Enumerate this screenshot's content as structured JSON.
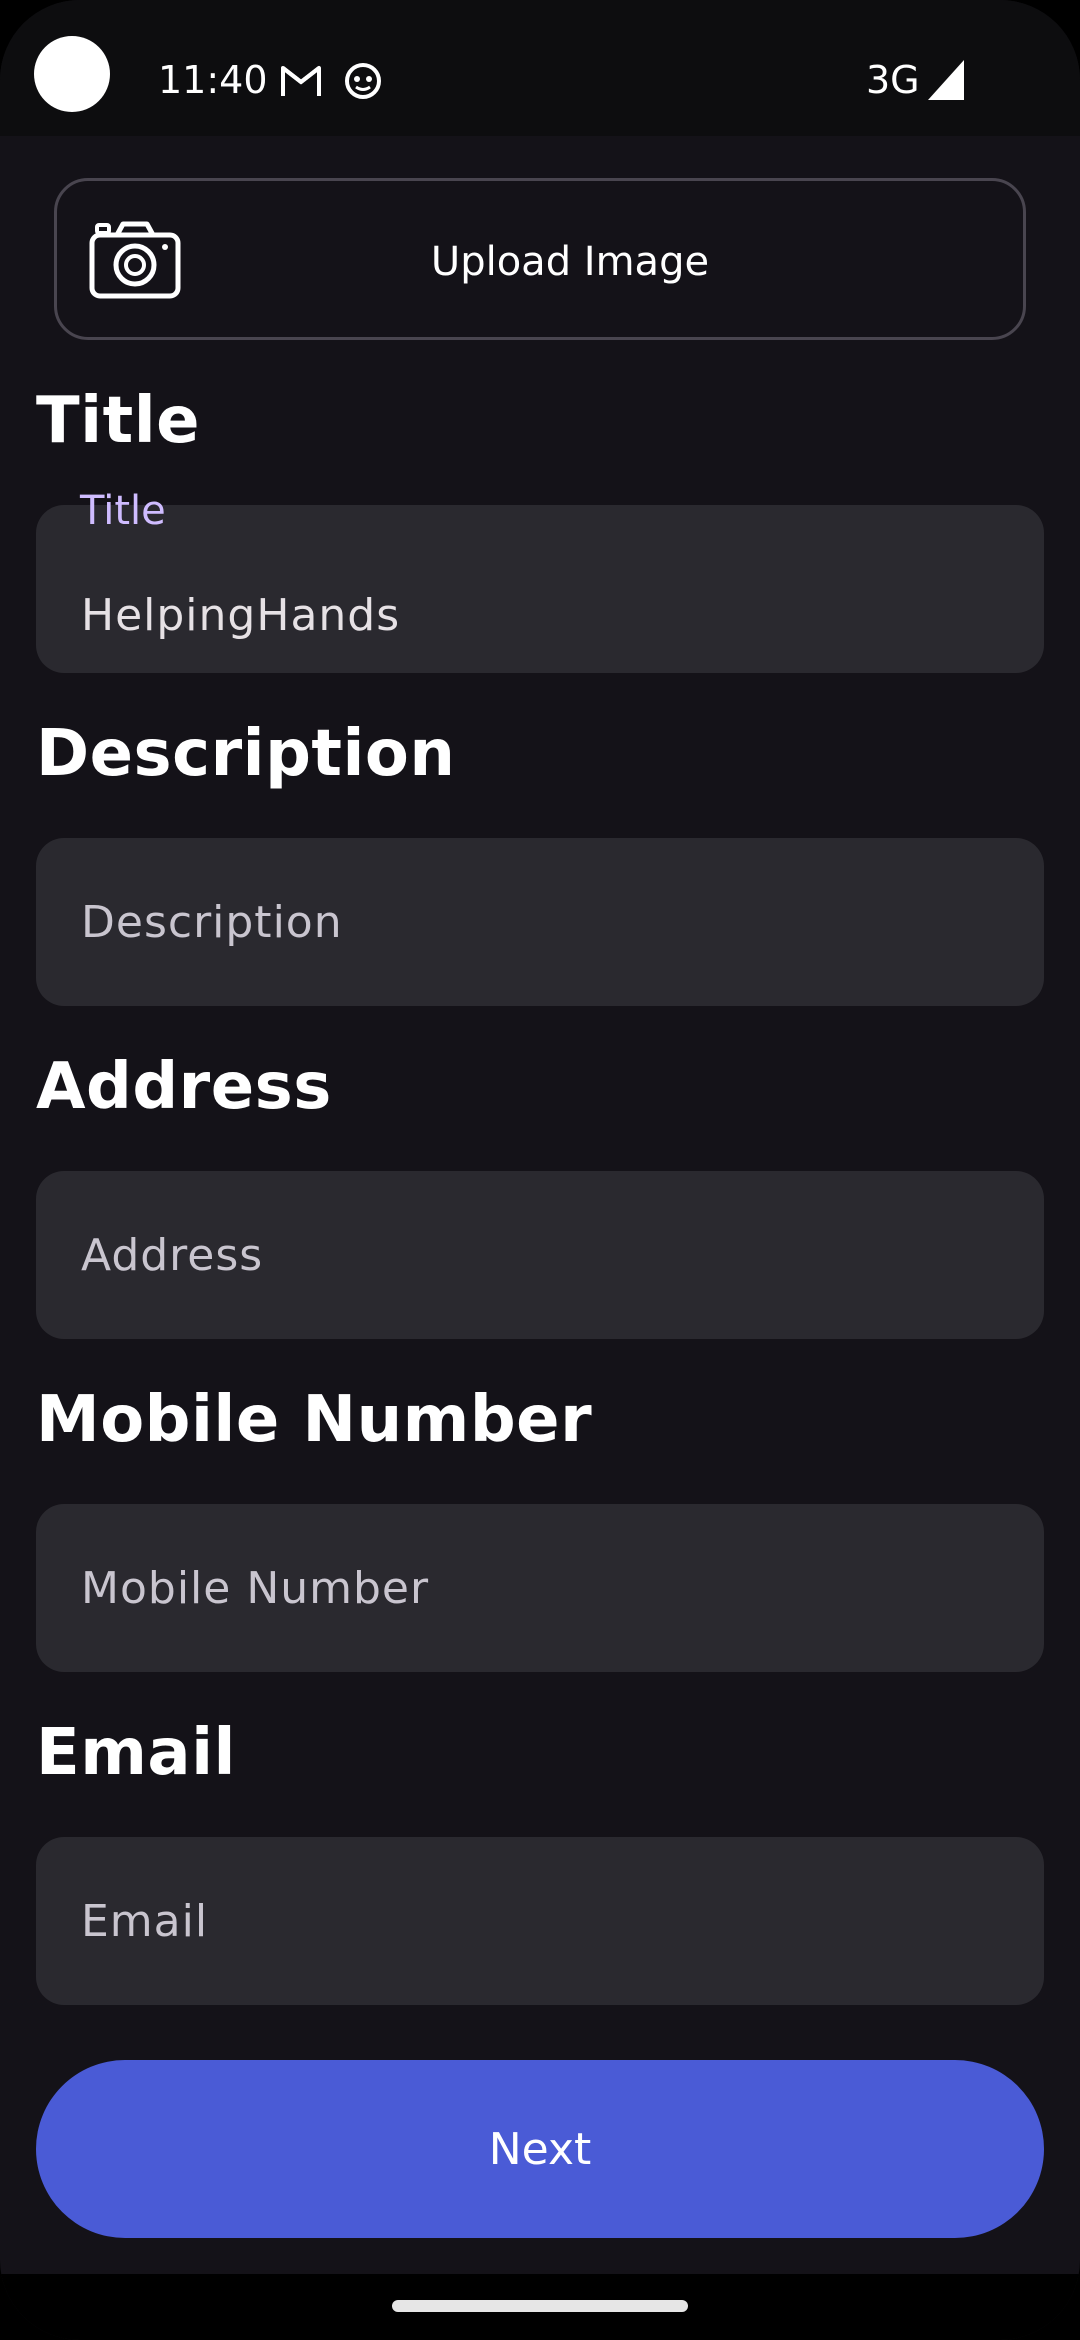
{
  "status_bar": {
    "time": "11:40",
    "network": "3G",
    "icons": [
      "gmail-icon",
      "android-bot-icon",
      "cell-signal-icon"
    ]
  },
  "upload": {
    "label": "Upload Image",
    "icon": "camera-icon"
  },
  "form": {
    "title": {
      "heading": "Title",
      "floating_label": "Title",
      "value": "HelpingHands",
      "placeholder": "Title"
    },
    "description": {
      "heading": "Description",
      "value": "",
      "placeholder": "Description"
    },
    "address": {
      "heading": "Address",
      "value": "",
      "placeholder": "Address"
    },
    "mobile": {
      "heading": "Mobile Number",
      "value": "",
      "placeholder": "Mobile Number"
    },
    "email": {
      "heading": "Email",
      "value": "",
      "placeholder": "Email"
    }
  },
  "actions": {
    "next_label": "Next"
  },
  "colors": {
    "background": "#141218",
    "field": "#2a292f",
    "accent": "#4a5bd6",
    "floating_label": "#cfbcff"
  }
}
